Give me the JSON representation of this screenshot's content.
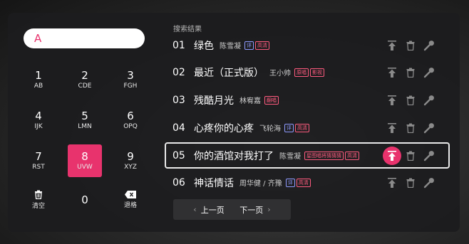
{
  "search": {
    "value": "A"
  },
  "keypad": {
    "keys": [
      {
        "num": "1",
        "letters": "AB"
      },
      {
        "num": "2",
        "letters": "CDE"
      },
      {
        "num": "3",
        "letters": "FGH"
      },
      {
        "num": "4",
        "letters": "IJK"
      },
      {
        "num": "5",
        "letters": "LMN"
      },
      {
        "num": "6",
        "letters": "OPQ"
      },
      {
        "num": "7",
        "letters": "RST"
      },
      {
        "num": "8",
        "letters": "UVW"
      },
      {
        "num": "9",
        "letters": "XYZ"
      },
      {
        "num": "0",
        "letters": ""
      }
    ],
    "active_key": "8",
    "clear_label": "清空",
    "backspace_label": "退格"
  },
  "results": {
    "title": "搜索结果",
    "rows": [
      {
        "index": "01",
        "song": "绿色",
        "artist": "陈雪凝",
        "badges": [
          {
            "text": "评",
            "color": "blue"
          },
          {
            "text": "高清",
            "color": "red"
          }
        ]
      },
      {
        "index": "02",
        "song": "最近（正式版）",
        "artist": "王小帅",
        "badges": [
          {
            "text": "原唱",
            "color": "red"
          },
          {
            "text": "影视",
            "color": "red"
          }
        ]
      },
      {
        "index": "03",
        "song": "残酷月光",
        "artist": "林宥嘉",
        "badges": [
          {
            "text": "翻唱",
            "color": "red"
          }
        ]
      },
      {
        "index": "04",
        "song": "心疼你的心疼",
        "artist": "飞轮海",
        "badges": [
          {
            "text": "评",
            "color": "blue"
          },
          {
            "text": "高清",
            "color": "red"
          }
        ]
      },
      {
        "index": "05",
        "song": "你的酒馆对我打了",
        "artist": "陈雪凝",
        "badges": [
          {
            "text": "星图唱将猜猜猜",
            "color": "red"
          },
          {
            "text": "高清",
            "color": "red"
          }
        ]
      },
      {
        "index": "06",
        "song": "神话情话",
        "artist": "周华健 / 齐豫",
        "badges": [
          {
            "text": "评",
            "color": "blue"
          },
          {
            "text": "高清",
            "color": "red"
          }
        ]
      }
    ],
    "selected_index": "05"
  },
  "pagination": {
    "prev_label": "上一页",
    "next_label": "下一页"
  },
  "colors": {
    "accent": "#e8336d",
    "panel": "#1c1c1e"
  }
}
